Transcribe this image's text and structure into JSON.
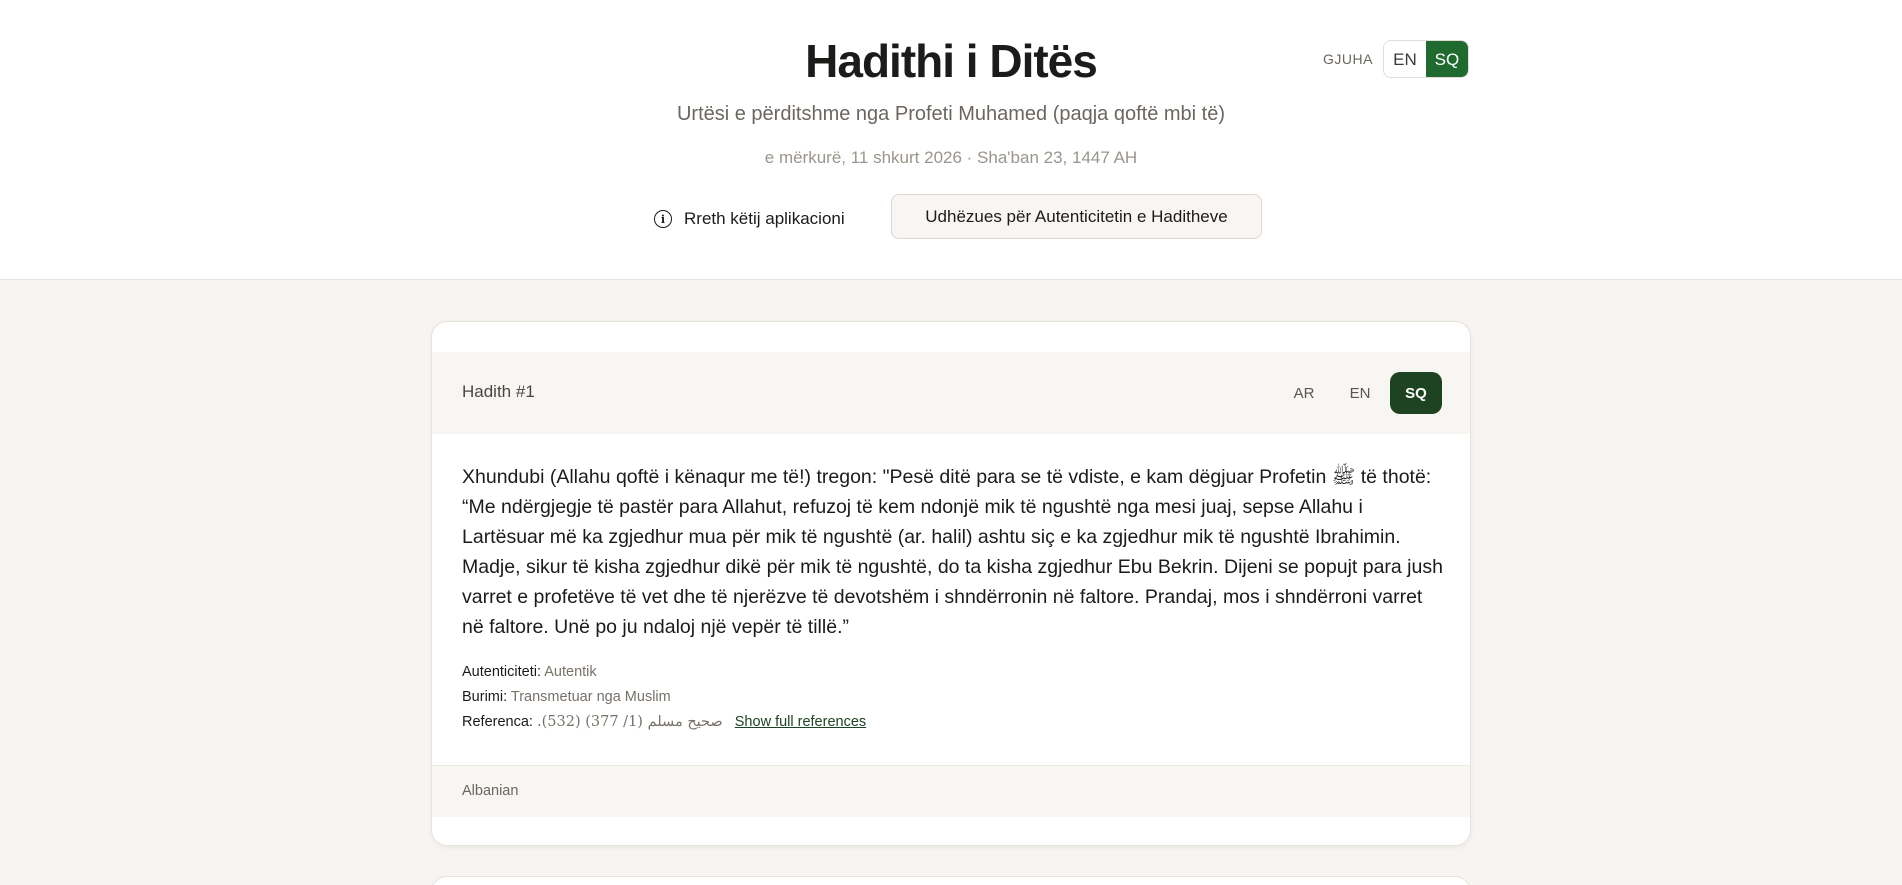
{
  "header": {
    "title": "Hadithi i Ditës",
    "subtitle": "Urtësi e përditshme nga Profeti Muhamed (paqja qoftë mbi të)",
    "date": "e mërkurë, 11 shkurt 2026 · Sha'ban 23, 1447 AH",
    "language_label": "GJUHA",
    "languages": [
      {
        "label": "EN",
        "active": false
      },
      {
        "label": "SQ",
        "active": true
      }
    ],
    "about_link": "Rreth këtij aplikacioni",
    "about_icon": "info-icon",
    "guide_button": "Udhëzues për Autenticitetin e Haditheve"
  },
  "hadith": {
    "number": "Hadith #1",
    "translation_tabs": [
      "AR",
      "EN",
      "SQ"
    ],
    "active_tab": "SQ",
    "text": "Xhundubi (Allahu qoftë i kënaqur me të!) tregon: \"Pesë ditë para se të vdiste, e kam dëgjuar Profetin ﷺ të thotë: “Me ndërgjegje të pastër para Allahut, refuzoj të kem ndonjë mik të ngushtë nga mesi juaj, sepse Allahu i Lartësuar më ka zgjedhur mua për mik të ngushtë (ar. halil) ashtu siç e ka zgjedhur mik të ngushtë Ibrahimin. Madje, sikur të kisha zgjedhur dikë për mik të ngushtë, do ta kisha zgjedhur Ebu Bekrin. Dijeni se popujt para jush varret e profetëve të vet dhe të njerëzve të devotshëm i shndërronin në faltore. Prandaj, mos i shndërroni varret në faltore. Unë po ju ndaloj një vepër të tillë.”",
    "authenticity_label": "Autenticiteti:",
    "authenticity_value": "Autentik",
    "source_label": "Burimi:",
    "source_value": "Transmetuar nga Muslim",
    "reference_label": "Referenca:",
    "reference_value": "صحيح مسلم (1/ 377) (532).",
    "full_refs_link": "Show full references",
    "footer_language": "Albanian"
  }
}
